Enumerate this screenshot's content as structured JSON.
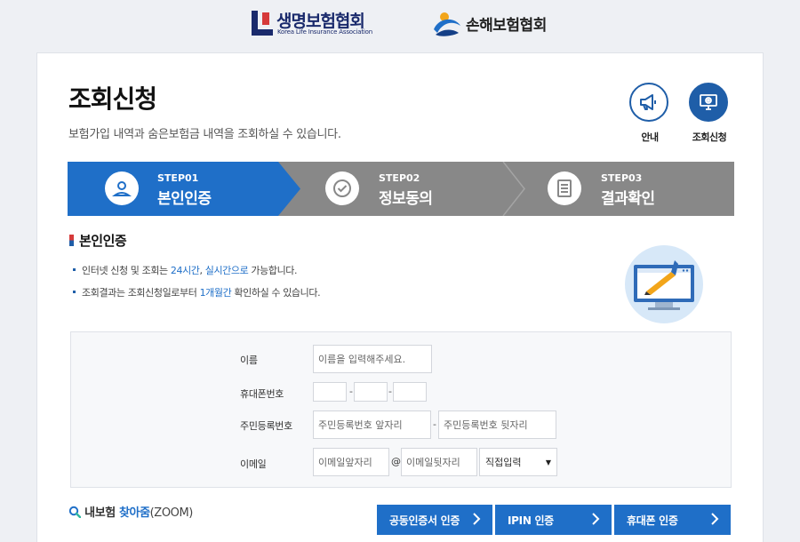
{
  "header": {
    "logo_life": {
      "name": "생명보험협회",
      "sub": "Korea Life Insurance Association"
    },
    "logo_nonlife": {
      "name": "손해보험협회"
    }
  },
  "page": {
    "title": "조회신청",
    "description": "보험가입 내역과 숨은보험금 내역을 조회하실 수 있습니다."
  },
  "top_icons": [
    {
      "label": "안내",
      "icon": "megaphone-icon"
    },
    {
      "label": "조회신청",
      "icon": "monitor-icon"
    }
  ],
  "steps": [
    {
      "num": "STEP01",
      "name": "본인인증",
      "active": true,
      "icon": "person-icon"
    },
    {
      "num": "STEP02",
      "name": "정보동의",
      "active": false,
      "icon": "check-icon"
    },
    {
      "num": "STEP03",
      "name": "결과확인",
      "active": false,
      "icon": "document-icon"
    }
  ],
  "section": {
    "title": "본인인증",
    "notes": [
      {
        "pre": "인터넷 신청 및 조회는 ",
        "hl1": "24시간",
        "mid": ", ",
        "hl2": "실시간으로",
        "post": " 가능합니다."
      },
      {
        "pre": "조회결과는 조회신청일로부터 ",
        "hl1": "1개월간",
        "post": " 확인하실 수 있습니다."
      }
    ]
  },
  "form": {
    "name": {
      "label": "이름",
      "placeholder": "이름을 입력해주세요."
    },
    "phone": {
      "label": "휴대폰번호",
      "sep": "-"
    },
    "rrn": {
      "label": "주민등록번호",
      "front_placeholder": "주민등록번호 앞자리",
      "back_placeholder": "주민등록번호 뒷자리",
      "sep": "-"
    },
    "email": {
      "label": "이메일",
      "front_placeholder": "이메일앞자리",
      "at": "@",
      "back_placeholder": "이메일뒷자리",
      "domain_selected": "직접입력"
    }
  },
  "zoom": {
    "part1": "내보험 ",
    "part2": "찾아줌",
    "part3": "(ZOOM)"
  },
  "auth_buttons": [
    {
      "label": "공동인증서 인증"
    },
    {
      "label": "IPIN 인증"
    },
    {
      "label": "휴대폰 인증"
    }
  ],
  "colors": {
    "accent": "#1f6fc8",
    "step_active": "#1f6fc8",
    "step_inactive": "#888888",
    "brand_navy": "#1a2a6c"
  }
}
